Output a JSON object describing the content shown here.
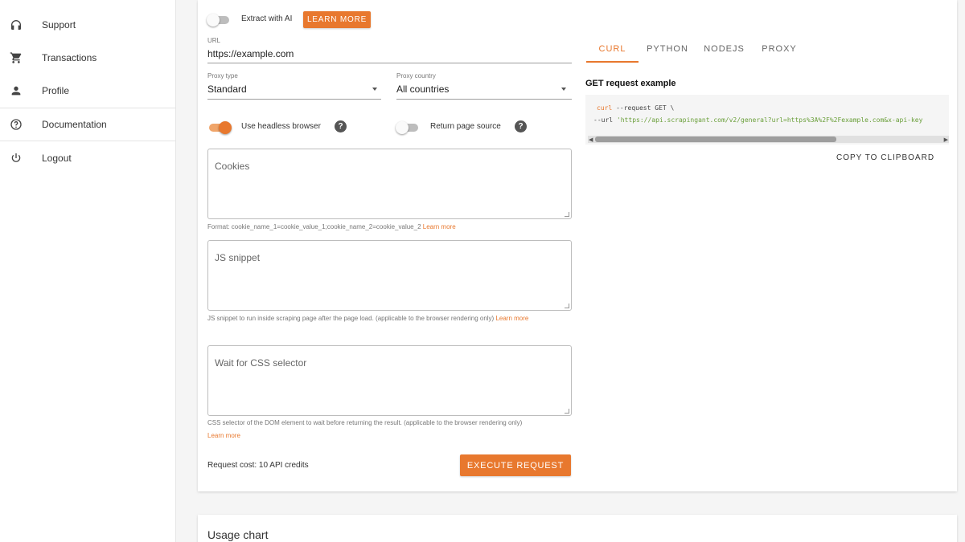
{
  "sidebar": {
    "items": [
      {
        "label": "Support",
        "icon": "headphones-icon"
      },
      {
        "label": "Transactions",
        "icon": "cart-icon"
      },
      {
        "label": "Profile",
        "icon": "person-icon"
      },
      {
        "label": "Documentation",
        "icon": "help-circle-icon"
      },
      {
        "label": "Logout",
        "icon": "power-icon"
      }
    ]
  },
  "form": {
    "extract_ai_label": "Extract with AI",
    "learn_more_button": "LEARN MORE",
    "url_label": "URL",
    "url_value": "https://example.com",
    "proxy_type_label": "Proxy type",
    "proxy_type_value": "Standard",
    "proxy_country_label": "Proxy country",
    "proxy_country_value": "All countries",
    "headless_label": "Use headless browser",
    "headless_on": true,
    "return_source_label": "Return page source",
    "return_source_on": false,
    "cookies_placeholder": "Cookies",
    "cookies_hint": "Format: cookie_name_1=cookie_value_1;cookie_name_2=cookie_value_2",
    "js_placeholder": "JS snippet",
    "js_hint": "JS snippet to run inside scraping page after the page load. (applicable to the browser rendering only)",
    "css_placeholder": "Wait for CSS selector",
    "css_hint": "CSS selector of the DOM element to wait before returning the result. (applicable to the browser rendering only)",
    "learn_more_link": "Learn more",
    "request_cost": "Request cost: 10 API credits",
    "execute_button": "EXECUTE REQUEST"
  },
  "code_panel": {
    "tabs": [
      "CURL",
      "PYTHON",
      "NODEJS",
      "PROXY"
    ],
    "active_tab": "CURL",
    "title": "GET request example",
    "line1_cmd": "curl",
    "line1_rest": " --request GET \\",
    "line2_flag": "--url",
    "line2_url": "'https://api.scrapingant.com/v2/general?url=https%3A%2F%2Fexample.com&x-api-key",
    "copy_button": "COPY TO CLIPBOARD"
  },
  "usage": {
    "title": "Usage chart"
  },
  "colors": {
    "accent": "#e8782e"
  }
}
